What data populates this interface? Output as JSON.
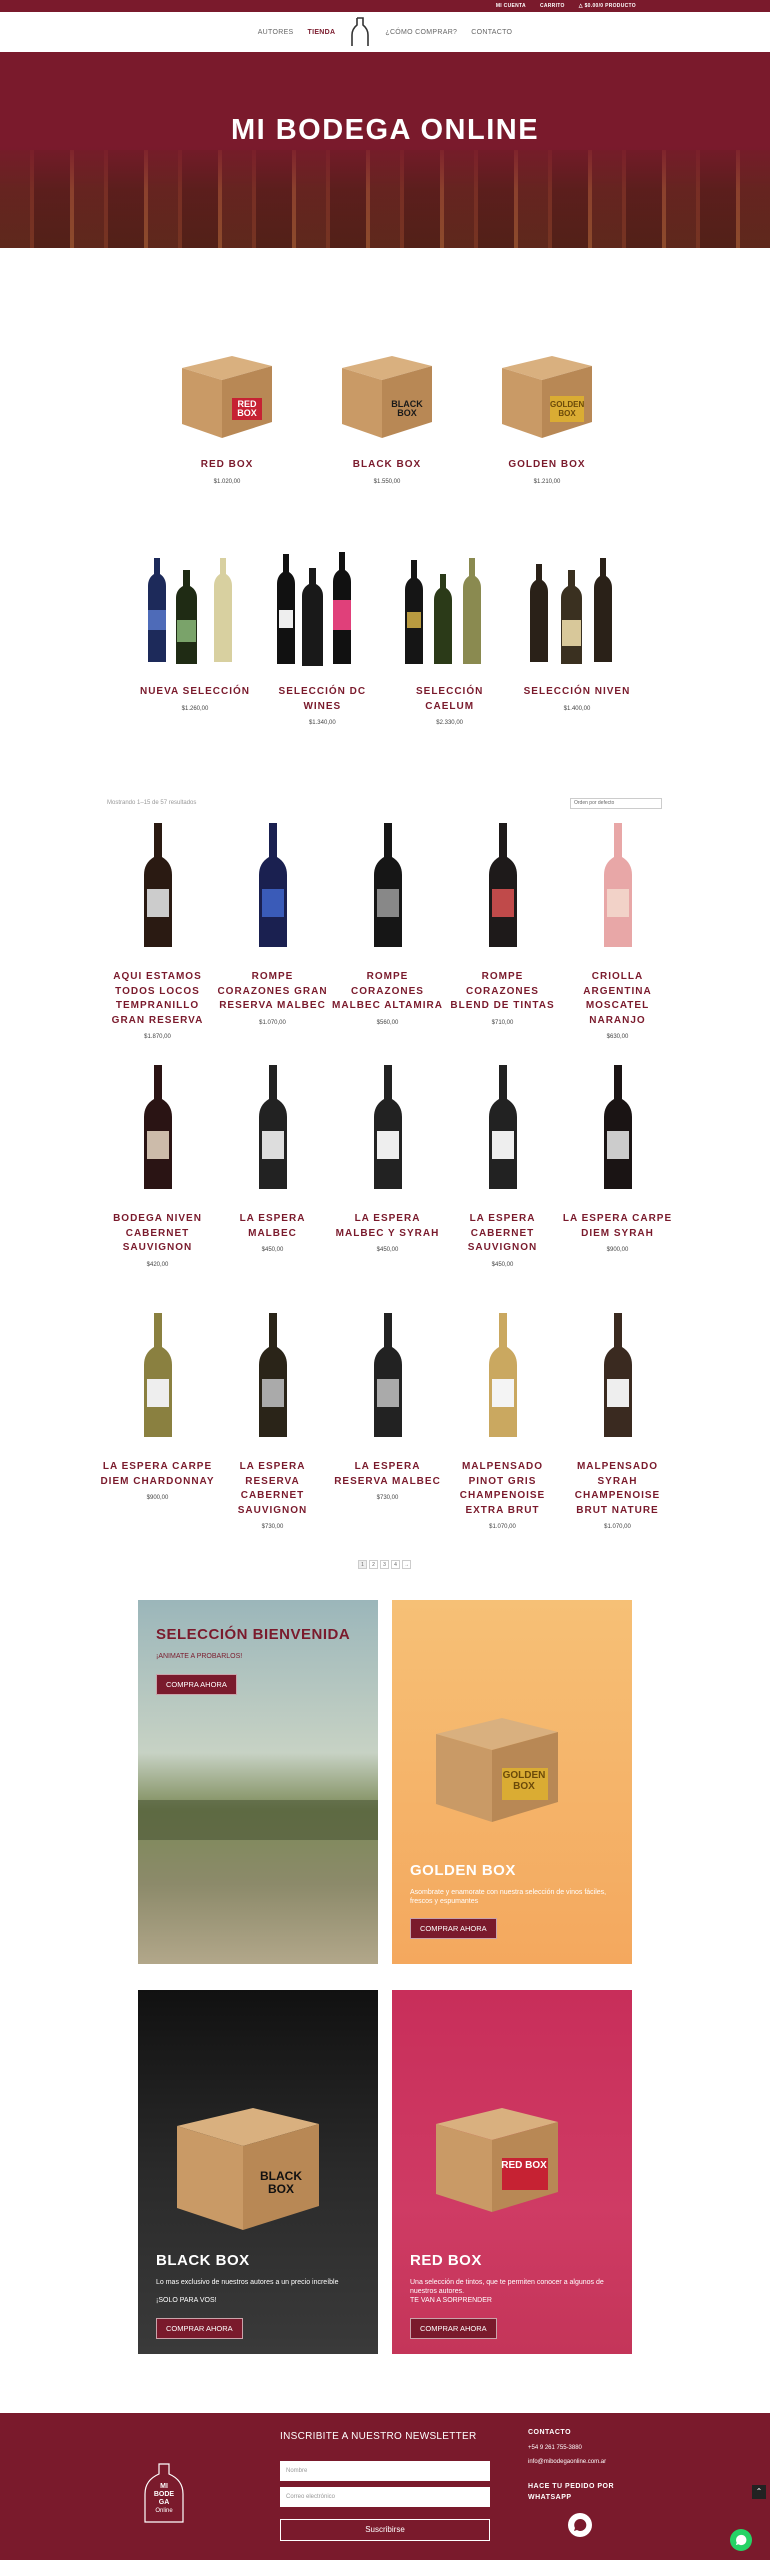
{
  "topbar": {
    "account": "MI CUENTA",
    "cart": "CARRITO",
    "cart_amount": "$0.00/0 PRODUCTO"
  },
  "nav": {
    "items": [
      {
        "label": "AUTORES"
      },
      {
        "label": "TIENDA"
      },
      {
        "label": "¿CÓMO COMPRAR?"
      },
      {
        "label": "CONTACTO"
      }
    ]
  },
  "hero": {
    "title": "MI BODEGA ONLINE"
  },
  "boxes": [
    {
      "name": "RED BOX",
      "price": "$1.020,00",
      "box_text": "RED BOX",
      "color": "#c8102e"
    },
    {
      "name": "BLACK BOX",
      "price": "$1.550,00",
      "box_text": "BLACK BOX",
      "color": "#1a1a1a"
    },
    {
      "name": "GOLDEN BOX",
      "price": "$1.210,00",
      "box_text": "GOLDEN BOX",
      "color": "#e2b52b"
    }
  ],
  "selections": [
    {
      "name": "NUEVA SELECCIÓN",
      "price": "$1.260,00"
    },
    {
      "name": "SELECCIÓN DC WINES",
      "price": "$1.340,00"
    },
    {
      "name": "SELECCIÓN CAELUM",
      "price": "$2.330,00"
    },
    {
      "name": "SELECCIÓN NIVEN",
      "price": "$1.400,00"
    }
  ],
  "shop": {
    "results": "Mostrando 1–15 de 57 resultados",
    "sort": "Orden por defecto",
    "pages": [
      "1",
      "2",
      "3",
      "4",
      "→"
    ]
  },
  "products": [
    {
      "name": "AQUI ESTAMOS TODOS LOCOS TEMPRANILLO GRAN RESERVA",
      "price": "$1.870,00"
    },
    {
      "name": "ROMPE CORAZONES GRAN RESERVA MALBEC",
      "price": "$1.070,00"
    },
    {
      "name": "ROMPE CORAZONES MALBEC ALTAMIRA",
      "price": "$560,00"
    },
    {
      "name": "ROMPE CORAZONES BLEND DE TINTAS",
      "price": "$710,00"
    },
    {
      "name": "CRIOLLA ARGENTINA MOSCATEL NARANJO",
      "price": "$630,00"
    },
    {
      "name": "BODEGA NIVEN CABERNET SAUVIGNON",
      "price": "$420,00"
    },
    {
      "name": "LA ESPERA MALBEC",
      "price": "$450,00"
    },
    {
      "name": "LA ESPERA MALBEC Y SYRAH",
      "price": "$450,00"
    },
    {
      "name": "LA ESPERA CABERNET SAUVIGNON",
      "price": "$450,00"
    },
    {
      "name": "LA ESPERA CARPE DIEM SYRAH",
      "price": "$900,00"
    },
    {
      "name": "LA ESPERA CARPE DIEM CHARDONNAY",
      "price": "$900,00"
    },
    {
      "name": "LA ESPERA RESERVA CABERNET SAUVIGNON",
      "price": "$730,00"
    },
    {
      "name": "LA ESPERA RESERVA MALBEC",
      "price": "$730,00"
    },
    {
      "name": "MALPENSADO PINOT GRIS CHAMPENOISE EXTRA BRUT",
      "price": "$1.070,00"
    },
    {
      "name": "MALPENSADO SYRAH CHAMPENOISE BRUT NATURE",
      "price": "$1.070,00"
    }
  ],
  "promos": {
    "bienvenida": {
      "title": "SELECCIÓN BIENVENIDA",
      "sub": "¡ANIMATE A PROBARLOS!",
      "btn": "COMPRA AHORA"
    },
    "golden": {
      "title": "GOLDEN BOX",
      "sub": "Asombrate y enamorate con nuestra selección de vinos fáciles, frescos y espumantes",
      "btn": "COMPRAR AHORA",
      "box_text": "GOLDEN BOX"
    },
    "black": {
      "title": "BLACK BOX",
      "sub": "Lo mas exclusivo de nuestros autores a un precio increíble",
      "sub2": "¡SOLO PARA VOS!",
      "btn": "COMPRAR AHORA",
      "box_text": "BLACK BOX"
    },
    "red": {
      "title": "RED BOX",
      "sub": "Una selección de tintos, que te permiten conocer a algunos de nuestros autores.",
      "sub2": "TE VAN A SORPRENDER",
      "btn": "COMPRAR AHORA",
      "box_text": "RED BOX"
    }
  },
  "footer": {
    "logo": [
      "MI",
      "BODE",
      "GA",
      "Online"
    ],
    "newsletter_title": "INSCRIBITE A NUESTRO NEWSLETTER",
    "name_placeholder": "Nombre",
    "email_placeholder": "Correo electrónico",
    "subscribe": "Suscribirse",
    "contact_title": "CONTACTO",
    "phone": "+54 9 261 755-3880",
    "email": "info@mibodegaonline.com.ar",
    "whatsapp": "HACE TU PEDIDO POR WHATSAPP"
  }
}
